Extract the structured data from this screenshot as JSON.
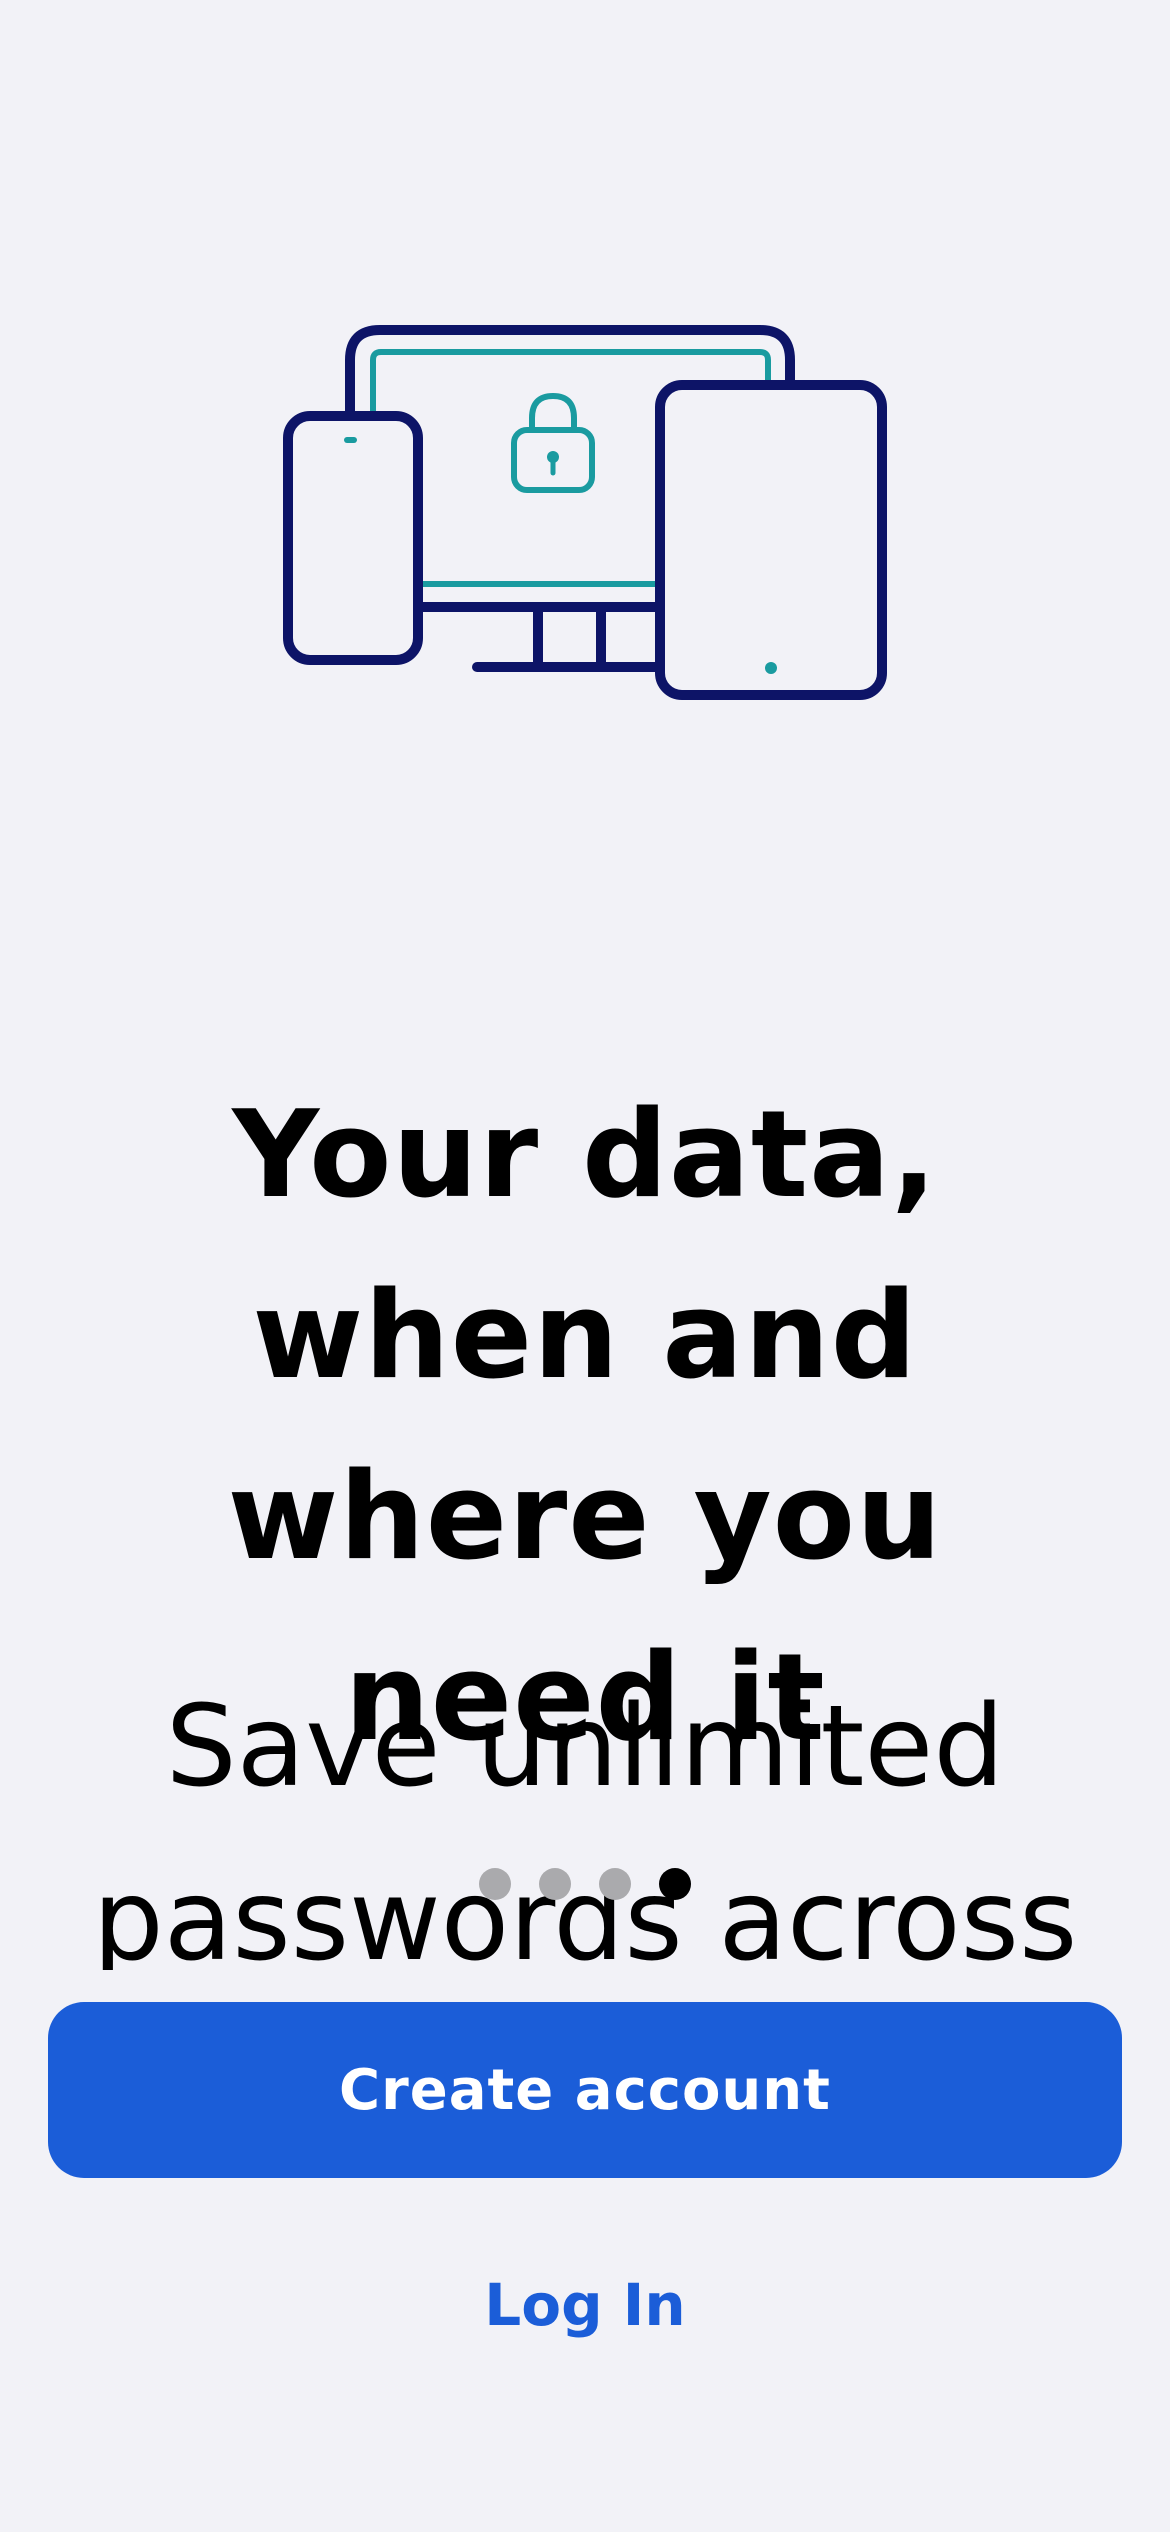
{
  "onboarding": {
    "headline": "Your data, when and where you need it",
    "body": "Save unlimited passwords across unlimited devices",
    "pager": {
      "total": 4,
      "active_index": 3
    }
  },
  "actions": {
    "create_account_label": "Create account",
    "login_label": "Log In"
  },
  "colors": {
    "background": "#f2f2f7",
    "primary": "#1b5dd8",
    "illustration_navy": "#0d1467",
    "illustration_teal": "#1a9ba0"
  },
  "icons": {
    "illustration": "devices-lock-illustration"
  }
}
